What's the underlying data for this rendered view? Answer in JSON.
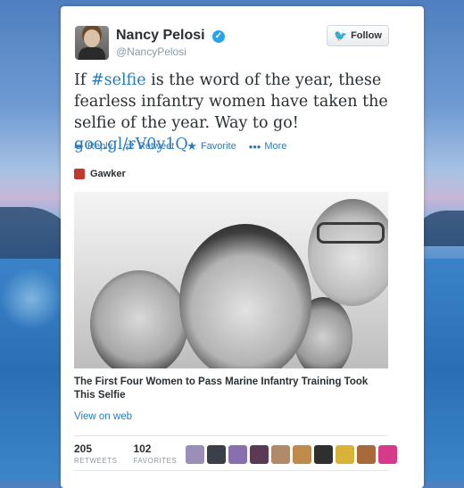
{
  "tweet": {
    "author_name": "Nancy Pelosi",
    "author_handle": "@NancyPelosi",
    "follow_label": "Follow",
    "text_before": "If ",
    "hashtag": "#selfie",
    "text_middle": " is the word of the year, these fearless infantry women have taken the selfie of the year. Way to go! ",
    "link": "goo.gl/rV0y1Q",
    "actions": [
      {
        "label": "Reply",
        "icon": "reply-icon"
      },
      {
        "label": "Retweet",
        "icon": "retweet-icon"
      },
      {
        "label": "Favorite",
        "icon": "star-icon"
      },
      {
        "label": "More",
        "icon": "more-icon"
      }
    ]
  },
  "card": {
    "source_name": "Gawker",
    "headline": "The First Four Women to Pass Marine Infantry Training Took This Selfie",
    "view_on_web": "View on web"
  },
  "stats": {
    "retweets_count": "205",
    "retweets_label": "RETWEETS",
    "favorites_count": "102",
    "favorites_label": "FAVORITES"
  },
  "favoriters": [
    {
      "color": "#9b8fb8"
    },
    {
      "color": "#3a3f4a"
    },
    {
      "color": "#8a6fae"
    },
    {
      "color": "#5b3a55"
    },
    {
      "color": "#b08a6a"
    },
    {
      "color": "#c08a4a"
    },
    {
      "color": "#2f2f2f"
    },
    {
      "color": "#d9b23a"
    },
    {
      "color": "#a86a3a"
    },
    {
      "color": "#d83a8a"
    }
  ],
  "colors": {
    "link": "#2b7bb9",
    "verified": "#2aa3ef",
    "text": "#292f33",
    "muted": "#8899a6"
  }
}
